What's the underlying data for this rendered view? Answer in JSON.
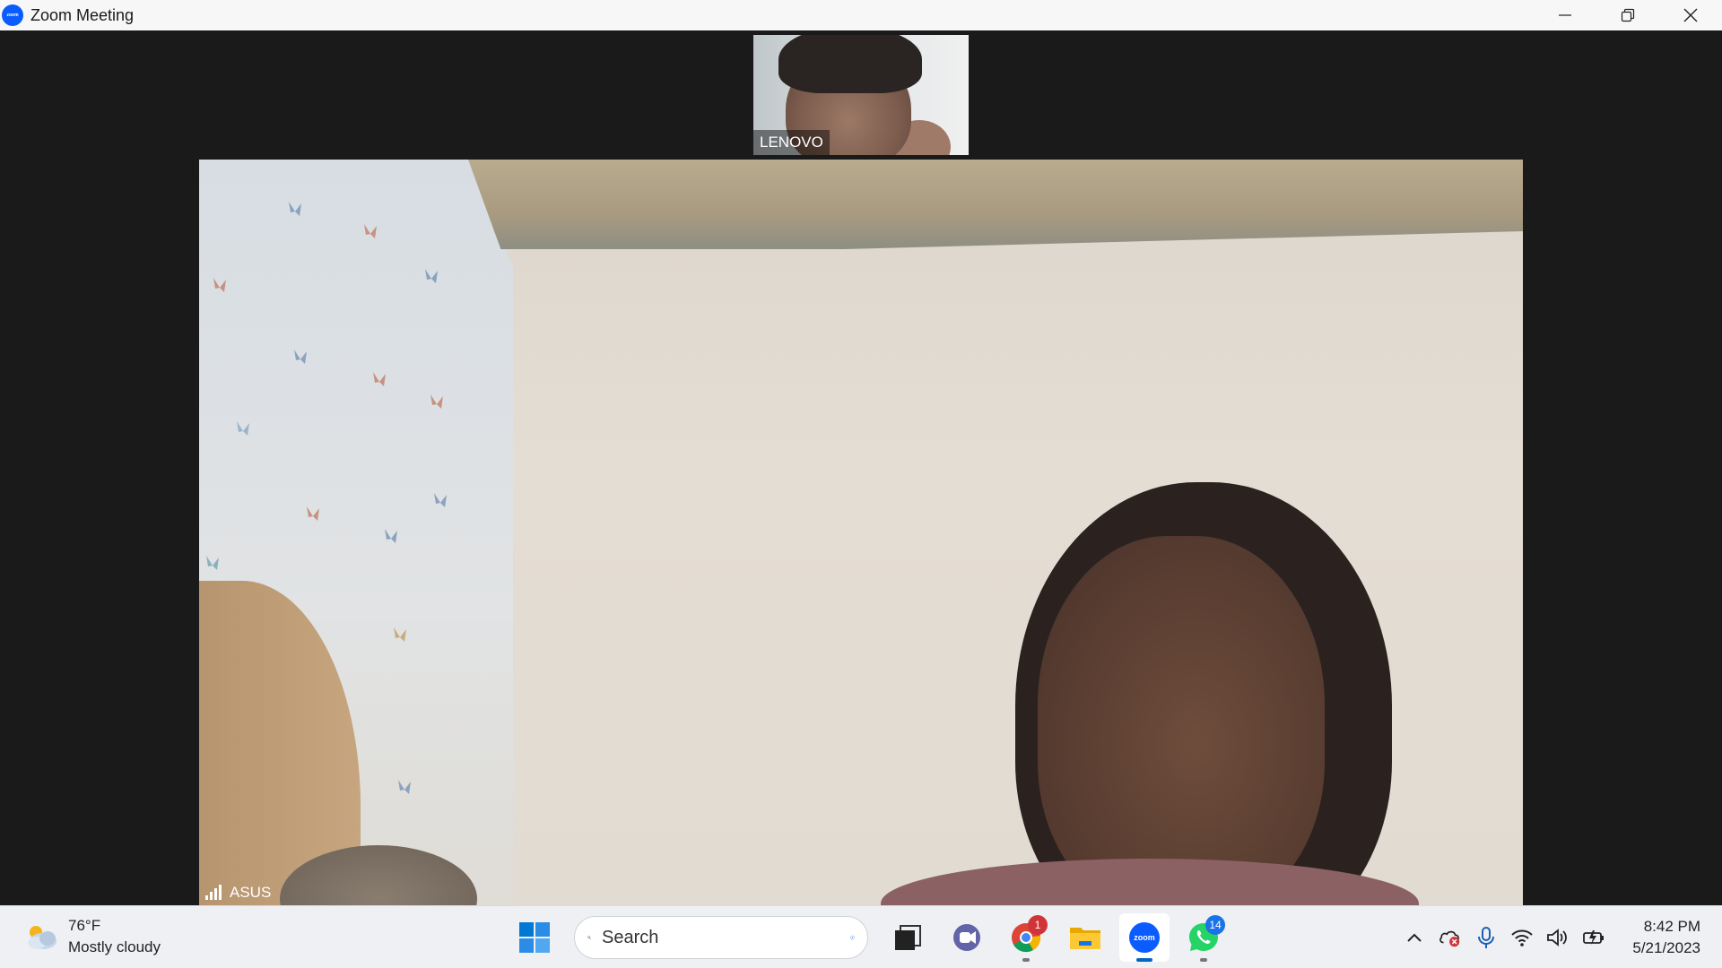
{
  "window": {
    "title": "Zoom Meeting",
    "app_logo_text": "zoom"
  },
  "meeting": {
    "thumbnail": {
      "name": "LENOVO"
    },
    "main": {
      "name": "ASUS"
    }
  },
  "taskbar": {
    "weather": {
      "temperature": "76°F",
      "condition": "Mostly cloudy"
    },
    "search": {
      "placeholder": "Search"
    },
    "chrome_badge": "1",
    "whatsapp_badge": "14",
    "zoom_label": "zoom",
    "clock": {
      "time": "8:42 PM",
      "date": "5/21/2023"
    }
  },
  "colors": {
    "zoom_blue": "#0b5cff",
    "windows_blue": "#0078d4",
    "badge_red": "#d13438",
    "whatsapp_green": "#25d366"
  }
}
